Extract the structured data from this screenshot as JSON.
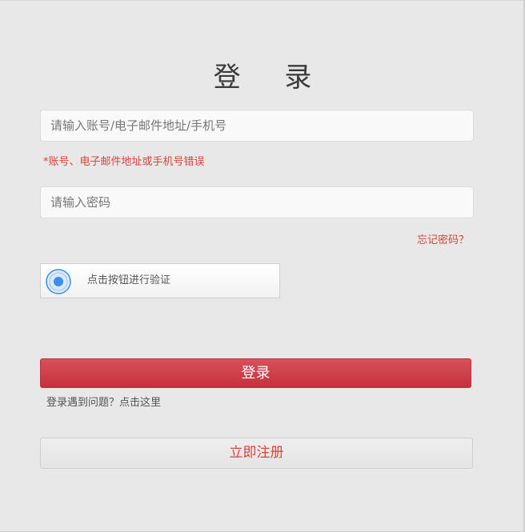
{
  "page": {
    "title": "登 录"
  },
  "form": {
    "account_placeholder": "请输入账号/电子邮件地址/手机号",
    "account_error": "*账号、电子邮件地址或手机号错误",
    "password_placeholder": "请输入密码",
    "forgot_password": "忘记密码？",
    "captcha_label": "点击按钮进行验证",
    "captcha_icon": "shield-check-icon",
    "login_label": "登录",
    "help_text": "登录遇到问题？点击这里",
    "register_label": "立即注册"
  },
  "colors": {
    "accent": "#c93540",
    "error": "#d9433b",
    "background": "#e8e8e8",
    "captcha_icon": "#3d8ef0"
  }
}
